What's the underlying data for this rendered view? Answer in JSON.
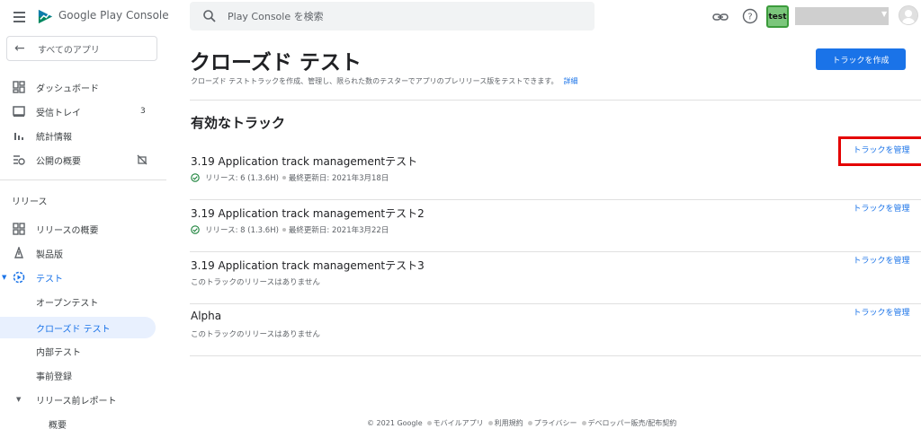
{
  "header": {
    "brand_primary": "Google Play",
    "brand_secondary": "Console",
    "search_placeholder": "Play Console を検索",
    "developer_avatar_text": "test"
  },
  "sidebar": {
    "all_apps_label": "すべてのアプリ",
    "top_items": [
      {
        "label": "ダッシュボード",
        "icon": "dashboard-icon"
      },
      {
        "label": "受信トレイ",
        "icon": "inbox-icon",
        "badge": "3"
      },
      {
        "label": "統計情報",
        "icon": "bar-chart-icon"
      },
      {
        "label": "公開の概要",
        "icon": "publishing-overview-icon"
      }
    ],
    "section_label": "リリース",
    "release_items": [
      {
        "label": "リリースの概要",
        "icon": "release-overview-icon"
      },
      {
        "label": "製品版",
        "icon": "production-icon"
      },
      {
        "label": "テスト",
        "icon": "testing-icon"
      }
    ],
    "testing_subitems": [
      "オープンテスト",
      "クローズド テスト",
      "内部テスト",
      "事前登録"
    ],
    "prelaunch_label": "リリース前レポート",
    "prelaunch_subitems": [
      "概要"
    ]
  },
  "main": {
    "title": "クローズド テスト",
    "description": "クローズド テストトラックを作成、管理し、限られた数のテスターでアプリのプレリリース版をテストできます。",
    "details_link": "詳細",
    "create_button": "トラックを作成",
    "section_title": "有効なトラック",
    "tracks": [
      {
        "name": "3.19 Application track managementテスト",
        "release": "リリース: 6 (1.3.6H)",
        "updated": "最終更新日: 2021年3月18日",
        "manage": "トラックを管理"
      },
      {
        "name": "3.19 Application track managementテスト2",
        "release": "リリース: 8 (1.3.6H)",
        "updated": "最終更新日: 2021年3月22日",
        "manage": "トラックを管理"
      },
      {
        "name": "3.19 Application track managementテスト3",
        "empty": "このトラックのリリースはありません",
        "manage": "トラックを管理"
      },
      {
        "name": "Alpha",
        "empty": "このトラックのリリースはありません",
        "manage": "トラックを管理"
      }
    ]
  },
  "footer": {
    "copyright": "© 2021 Google",
    "links": [
      "モバイルアプリ",
      "利用規約",
      "プライバシー",
      "デベロッパー販売/配布契約"
    ]
  },
  "colors": {
    "accent": "#1a73e8",
    "highlight_border": "#e40000",
    "active_nav_bg": "#e8f0fe"
  }
}
